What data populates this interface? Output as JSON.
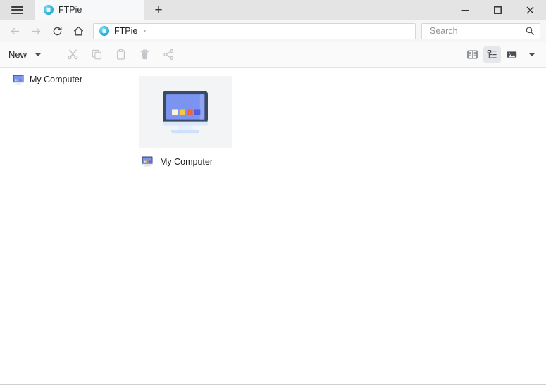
{
  "window": {
    "menu_icon": "hamburger-icon",
    "controls": {
      "minimize": "minimize-icon",
      "maximize": "maximize-icon",
      "close": "close-icon"
    }
  },
  "tabs": [
    {
      "title": "FTPie",
      "icon": "ftpie-icon",
      "active": true
    }
  ],
  "new_tab_label": "+",
  "nav": {
    "back": "back-arrow-icon",
    "forward": "forward-arrow-icon",
    "reload": "reload-icon",
    "home": "home-icon",
    "address": {
      "icon": "ftpie-icon",
      "crumb": "FTPie",
      "separator": "›"
    }
  },
  "search": {
    "placeholder": "Search",
    "value": "",
    "icon": "search-icon"
  },
  "toolbar": {
    "new_label": "New",
    "new_caret": "chevron-down-icon",
    "actions": [
      {
        "name": "cut-button",
        "icon": "scissors-icon",
        "enabled": false
      },
      {
        "name": "copy-button",
        "icon": "copy-icon",
        "enabled": false
      },
      {
        "name": "paste-button",
        "icon": "clipboard-icon",
        "enabled": false
      },
      {
        "name": "delete-button",
        "icon": "trash-icon",
        "enabled": false
      },
      {
        "name": "share-button",
        "icon": "share-icon",
        "enabled": false
      }
    ],
    "views": [
      {
        "name": "view-split-button",
        "icon": "split-pane-icon",
        "active": false
      },
      {
        "name": "view-tree-button",
        "icon": "tree-list-icon",
        "active": true
      },
      {
        "name": "view-thumbnails-button",
        "icon": "image-icon",
        "active": false
      }
    ],
    "view_caret": "chevron-down-icon"
  },
  "sidebar": {
    "items": [
      {
        "label": "My Computer",
        "icon": "computer-icon"
      }
    ]
  },
  "main": {
    "items": [
      {
        "label": "My Computer",
        "icon": "computer-icon",
        "thumb_icon": "computer-icon"
      }
    ]
  },
  "colors": {
    "accent": "#35b8e0",
    "screen": "#7b94ef",
    "bezel": "#3b4a63",
    "tile_bg": "#f3f4f6",
    "dot_cream": "#fdf4d8",
    "dot_yellow": "#f5c842",
    "dot_orange": "#f4643a",
    "dot_blue": "#4f5fe0"
  }
}
